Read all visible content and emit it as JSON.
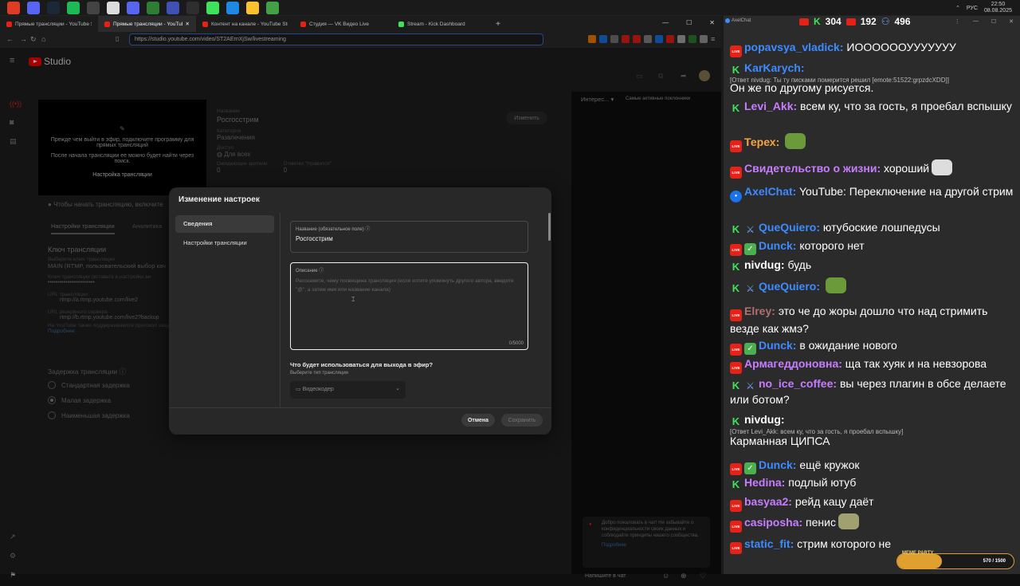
{
  "taskbar": {
    "icons": [
      {
        "name": "browser-icon",
        "color": "#e03b24"
      },
      {
        "name": "discord-icon",
        "color": "#5865f2"
      },
      {
        "name": "steam-icon",
        "color": "#1b2838"
      },
      {
        "name": "spotify-icon",
        "color": "#1db954"
      },
      {
        "name": "obs-icon",
        "color": "#444"
      },
      {
        "name": "game-icon",
        "color": "#ddd"
      },
      {
        "name": "app-icon",
        "color": "#5865f2"
      },
      {
        "name": "app-icon",
        "color": "#2e7d32"
      },
      {
        "name": "app-icon",
        "color": "#3f51b5"
      },
      {
        "name": "app-icon",
        "color": "#2e2e2e"
      },
      {
        "name": "app-icon",
        "color": "#3fe35b"
      },
      {
        "name": "app-icon",
        "color": "#1e88e5"
      },
      {
        "name": "app-icon",
        "color": "#fbc02d"
      },
      {
        "name": "app-icon",
        "color": "#43a047"
      }
    ],
    "lang": "РУС",
    "time": "22:50",
    "date": "08.08.2025"
  },
  "browser": {
    "tabs": [
      {
        "label": "Прямые трансляции - YouTube Stu",
        "color": "#e62117",
        "active": false
      },
      {
        "label": "Прямые трансляции - YouTube",
        "color": "#e62117",
        "active": true
      },
      {
        "label": "Контент на канале - YouTube Studio",
        "color": "#e62117",
        "active": false
      },
      {
        "label": "Студия — VK Видео Live",
        "color": "#e62117",
        "active": false
      },
      {
        "label": "Stream - Kick Dashboard",
        "color": "#3fe35b",
        "active": false
      }
    ],
    "new_tab": "+",
    "url": "https://studio.youtube.com/video/ST2AErnXjSw/livestreaming"
  },
  "studio": {
    "logo": "Studio",
    "preview_text1": "Прежде чем выйти в эфир, подключите программу для прямых трансляций",
    "preview_text2": "После начала трансляции ее можно будет найти через поиск.",
    "preview_settings": "Настройка трансляции",
    "name_label": "Название",
    "name_value": "Росгосстрим",
    "category_label": "Категория",
    "category_value": "Развлечения",
    "access_label": "Доступ",
    "access_value": "Для всех",
    "waiting_label": "Ожидающие зрители",
    "waiting_value": "0",
    "likes_label": "Отметки \"Нравится\"",
    "likes_value": "0",
    "edit_button": "Изменить",
    "start_hint": "Чтобы начать трансляцию, включите",
    "tab_settings": "Настройки трансляции",
    "tab_analytics": "Аналитика",
    "key_header": "Ключ трансляции",
    "key_select_label": "Выберите ключ трансляции",
    "key_select_value": "MAIN (RTMP, пользовательский выбор кач",
    "key_field_label": "Ключ трансляции (вставьте в настройки ви",
    "key_value": "••••••••••••••••••••••••",
    "url_label": "URL трансляции",
    "url_value": "rtmp://a.rtmp.youtube.com/live2",
    "backup_label": "URL резервного сервера",
    "backup_value": "rtmp://b.rtmp.youtube.com/live2?backup",
    "protocol_hint": "На YouTube также поддерживаются протокол защищ",
    "more_link": "Подробнее",
    "delay_header": "Задержка трансляции",
    "delay_options": [
      "Стандартная задержка",
      "Малая задержка",
      "Наименьшая задержка"
    ],
    "right_panel_dropdown": "Интерес...",
    "right_panel_label": "Самые активные поклонники",
    "welcome": "Добро пожаловать в чат! Не забывайте о конфиденциальности своих данных и соблюдайте принципы нашего сообщества.",
    "welcome_more": "Подробнее",
    "chat_placeholder": "Напишите в чат"
  },
  "modal": {
    "title": "Изменение настроек",
    "nav": [
      "Сведения",
      "Настройки трансляции"
    ],
    "title_field_label": "Название (обязательное поле)",
    "title_field_value": "Росгосстрим",
    "desc_label": "Описание",
    "desc_placeholder": "Расскажите, чему посвящена трансляция (если хотите упомянуть другого автора, введите \"@\", а затем имя или название канала)",
    "desc_counter": "0/5000",
    "output_question": "Что будет использоваться для выхода в эфир?",
    "output_hint": "Выберите тип трансляции",
    "output_value": "Видеокодер",
    "cancel": "Отмена",
    "save": "Сохранить"
  },
  "chat": {
    "title": "AxelChat",
    "youtube_count": "304",
    "vk_count": "192",
    "kick_count": "496",
    "messages": [
      {
        "badges": [
          "yt"
        ],
        "nick": "popavsya_vladick:",
        "nick_color": "#3d8bff",
        "text": "ИООООООУУУУУУУ"
      },
      {
        "badges": [
          "kick"
        ],
        "nick": "KarKarych:",
        "nick_color": "#3d8bff",
        "text": "",
        "reply": "[Ответ nivdug: Ты ту писками померится решил [emote:51522:grpzdcXDD]]"
      },
      {
        "badges": [],
        "nick": "",
        "nick_color": "#fff",
        "text": "Он же по другому рисуется."
      },
      {
        "badges": [
          "kick"
        ],
        "nick": "Levi_Akk:",
        "nick_color": "#c77dff",
        "text": "всем ку, что за гость, я проебал вспышку"
      },
      {
        "badges": [
          "yt"
        ],
        "nick": "Терех:",
        "nick_color": "#f7a440",
        "text": ""
      },
      {
        "badges": [
          "yt"
        ],
        "nick": "Свидетельство о жизни:",
        "nick_color": "#c77dff",
        "text": "хороший"
      },
      {
        "badges": [
          "axel"
        ],
        "nick": "AxelChat:",
        "nick_color": "#3d8bff",
        "text": "YouTube: Переключение на другой стрим"
      },
      {
        "badges": [
          "kick",
          "sword"
        ],
        "nick": "QueQuiero:",
        "nick_color": "#3d8bff",
        "text": "ютубоские лошпедусы"
      },
      {
        "badges": [
          "yt",
          "check"
        ],
        "nick": "Dunck:",
        "nick_color": "#3d8bff",
        "text": "которого нет"
      },
      {
        "badges": [
          "kick"
        ],
        "nick": "nivdug:",
        "nick_color": "#fff",
        "text": "будь"
      },
      {
        "badges": [
          "kick",
          "sword"
        ],
        "nick": "QueQuiero:",
        "nick_color": "#3d8bff",
        "text": ""
      },
      {
        "badges": [
          "yt"
        ],
        "nick": "Elrey:",
        "nick_color": "#b07070",
        "text": "это че до жоры дошло что над стримить везде как жмэ?"
      },
      {
        "badges": [
          "yt",
          "check"
        ],
        "nick": "Dunck:",
        "nick_color": "#3d8bff",
        "text": "в ожидание нового"
      },
      {
        "badges": [
          "yt"
        ],
        "nick": "Армагеддоновна:",
        "nick_color": "#c77dff",
        "text": "ща так хуяк и на невзорова"
      },
      {
        "badges": [
          "kick",
          "sword"
        ],
        "nick": "no_ice_coffee:",
        "nick_color": "#c77dff",
        "text": "вы через плагин в обсе делаете или ботом?"
      },
      {
        "badges": [
          "kick"
        ],
        "nick": "nivdug:",
        "nick_color": "#fff",
        "text": "",
        "reply": "[Ответ Levi_Akk: всем ку, что за гость, я проебал вспышку]"
      },
      {
        "badges": [],
        "nick": "",
        "nick_color": "#fff",
        "text": "Карманная ЦИПСА"
      },
      {
        "badges": [
          "yt",
          "check"
        ],
        "nick": "Dunck:",
        "nick_color": "#3d8bff",
        "text": "ещё кружок"
      },
      {
        "badges": [
          "kick"
        ],
        "nick": "Hedina:",
        "nick_color": "#c77dff",
        "text": "подлый ютуб"
      },
      {
        "badges": [
          "yt"
        ],
        "nick": "basyaa2:",
        "nick_color": "#c77dff",
        "text": "рейд кацу даёт"
      },
      {
        "badges": [
          "yt"
        ],
        "nick": "casiposha:",
        "nick_color": "#c77dff",
        "text": "пенис"
      },
      {
        "badges": [
          "yt"
        ],
        "nick": "static_fit:",
        "nick_color": "#3d8bff",
        "text": "стрим которого не"
      }
    ],
    "meme_party_label": "MEME PARTY",
    "meme_party_progress": "570 / 1500"
  },
  "colors": {
    "youtube": "#e62117",
    "kick": "#3fe35b",
    "accent": "#3ea6ff",
    "modal_bg": "#282828"
  }
}
